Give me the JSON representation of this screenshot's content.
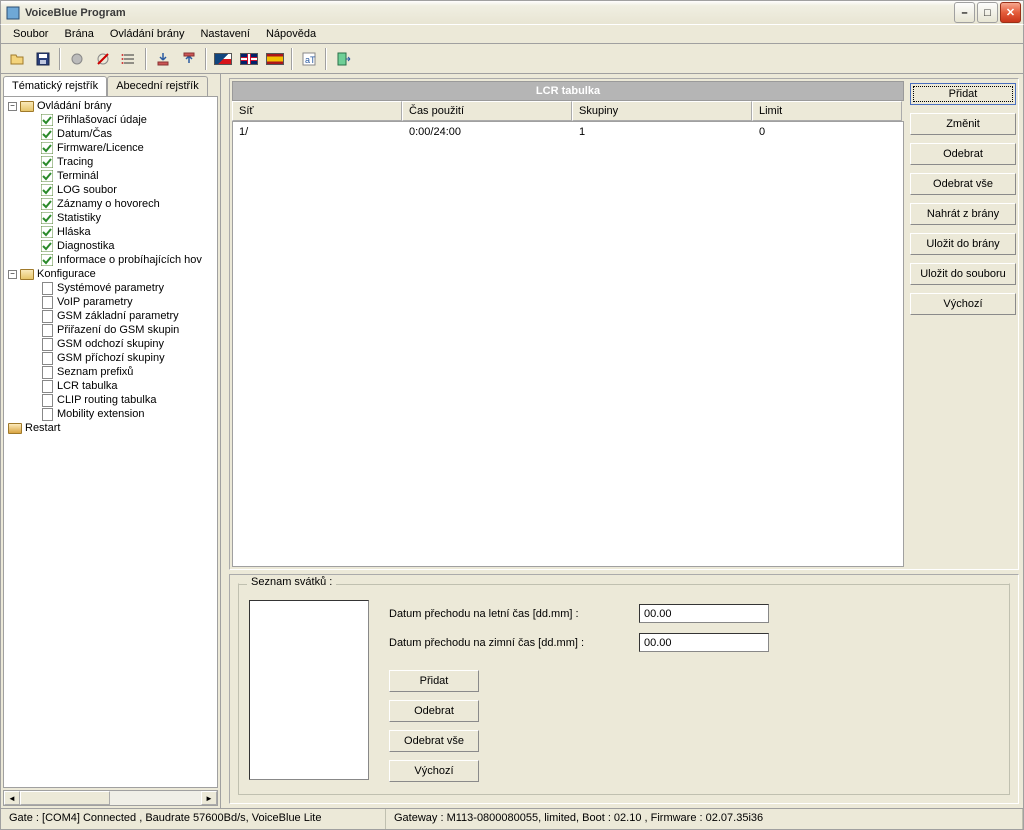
{
  "window": {
    "title": "VoiceBlue Program"
  },
  "menu": [
    "Soubor",
    "Brána",
    "Ovládání brány",
    "Nastavení",
    "Nápověda"
  ],
  "tabs": {
    "thematic": "Tématický rejstřík",
    "alphabetic": "Abecední rejstřík"
  },
  "tree": {
    "root1": "Ovládání brány",
    "root1_items": [
      "Přihlašovací údaje",
      "Datum/Čas",
      "Firmware/Licence",
      "Tracing",
      "Terminál",
      "LOG soubor",
      "Záznamy o hovorech",
      "Statistiky",
      "Hláska",
      "Diagnostika",
      "Informace o probíhajících hov"
    ],
    "root2": "Konfigurace",
    "root2_items": [
      "Systémové parametry",
      "VoIP parametry",
      "GSM základní parametry",
      "Přiřazení do GSM skupin",
      "GSM odchozí skupiny",
      "GSM příchozí skupiny",
      "Seznam prefixů",
      "LCR tabulka",
      "CLIP routing tabulka",
      "Mobility extension"
    ],
    "root3": "Restart"
  },
  "table": {
    "title": "LCR tabulka",
    "headers": {
      "c1": "Síť",
      "c2": "Čas použití",
      "c3": "Skupiny",
      "c4": "Limit"
    },
    "rows": [
      {
        "c1": "1/",
        "c2": "0:00/24:00",
        "c3": "1",
        "c4": "0"
      }
    ]
  },
  "side_buttons": [
    "Přidat",
    "Změnit",
    "Odebrat",
    "Odebrat vše",
    "Nahrát z brány",
    "Uložit do brány",
    "Uložit do souboru",
    "Výchozí"
  ],
  "holidays": {
    "legend": "Seznam svátků :",
    "summer_label": "Datum přechodu na letní čas [dd.mm] :",
    "summer_value": "00.00",
    "winter_label": "Datum přechodu na zimní čas [dd.mm] :",
    "winter_value": "00.00",
    "buttons": [
      "Přidat",
      "Odebrat",
      "Odebrat vše",
      "Výchozí"
    ]
  },
  "status": {
    "left": "Gate : [COM4] Connected , Baudrate 57600Bd/s, VoiceBlue Lite",
    "right": "Gateway : M113-0800080055, limited, Boot : 02.10 , Firmware : 02.07.35i36"
  }
}
